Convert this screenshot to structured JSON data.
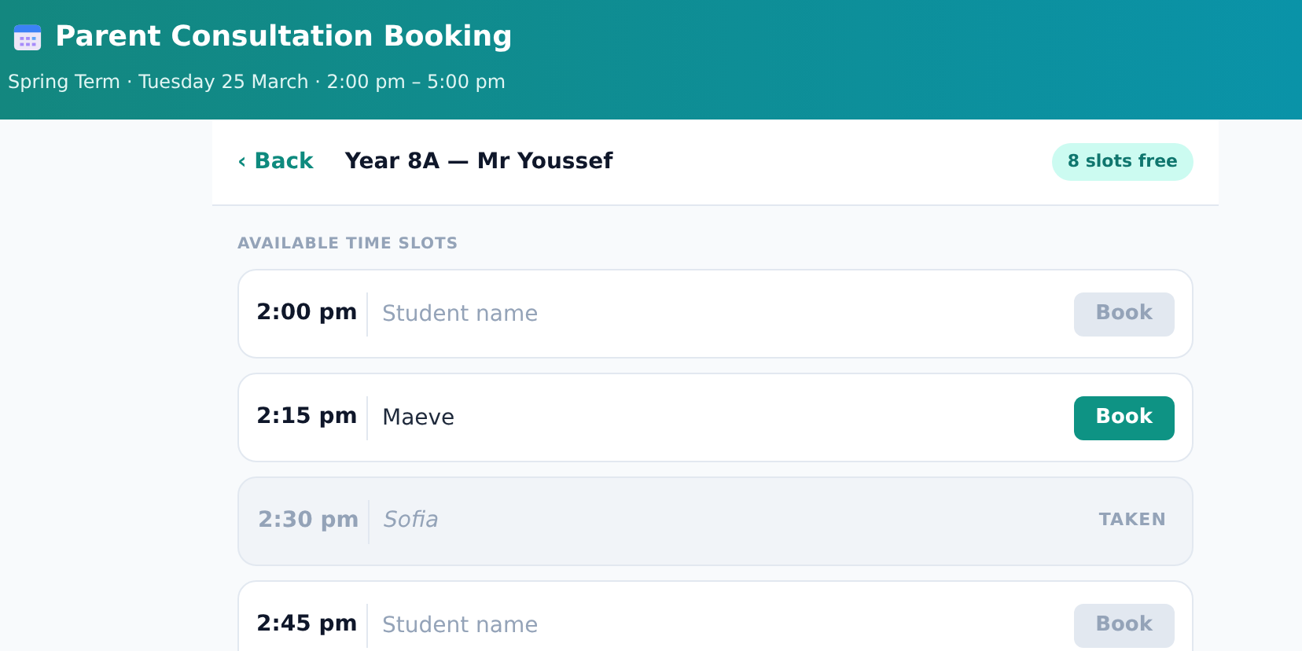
{
  "header": {
    "title": "Parent Consultation Booking",
    "subtitle": "Spring Term · Tuesday 25 March · 2:00 pm – 5:00 pm"
  },
  "card_header": {
    "back": "‹ Back",
    "title": "Year 8A — Mr Youssef",
    "badge": "8 slots free"
  },
  "section_label": "AVAILABLE TIME SLOTS",
  "slots": [
    {
      "kind": "open",
      "time": "2:00 pm",
      "placeholder": "Student name",
      "button": "Book",
      "disabled": true
    },
    {
      "kind": "open",
      "time": "2:15 pm",
      "value": "Maeve",
      "button": "Book",
      "disabled": false
    },
    {
      "kind": "taken",
      "time": "2:30 pm",
      "name": "Sofia",
      "status": "TAKEN"
    },
    {
      "kind": "open",
      "time": "2:45 pm",
      "placeholder": "Student name",
      "button": "Book",
      "disabled": true
    }
  ]
}
